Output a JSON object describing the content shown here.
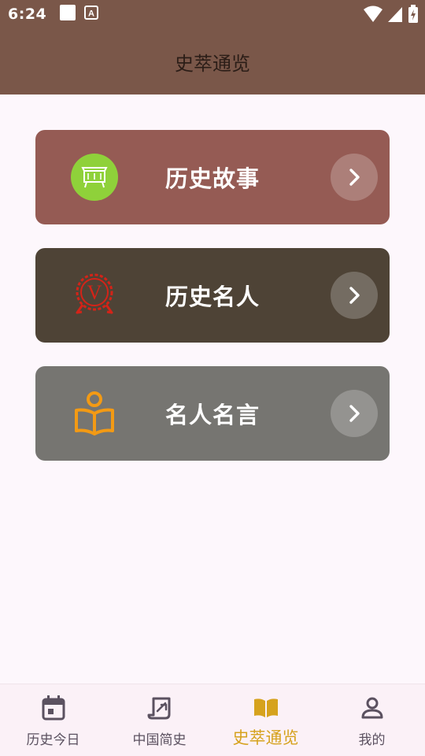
{
  "status_bar": {
    "time": "6:24",
    "icons": [
      "square-notification-icon",
      "font-a-notification-icon",
      "wifi-icon",
      "cell-signal-icon",
      "battery-charging-icon"
    ]
  },
  "app_bar": {
    "title": "史萃通览"
  },
  "cards": [
    {
      "label": "历史故事",
      "icon": "calligraphy-frame-icon",
      "background": "#955b54",
      "icon_color": "#8fd13a"
    },
    {
      "label": "历史名人",
      "icon": "v-seal-badge-icon",
      "background": "#4e4336",
      "icon_color": "#d42318"
    },
    {
      "label": "名人名言",
      "icon": "reading-person-icon",
      "background": "#767571",
      "icon_color": "#f39a14"
    }
  ],
  "bottom_nav": {
    "active_index": 2,
    "items": [
      {
        "label": "历史今日",
        "icon": "calendar-icon"
      },
      {
        "label": "中国简史",
        "icon": "scroll-history-icon"
      },
      {
        "label": "史萃通览",
        "icon": "open-book-icon"
      },
      {
        "label": "我的",
        "icon": "person-icon"
      }
    ]
  },
  "colors": {
    "header_background": "#7a5749",
    "page_background": "#fdf7fc",
    "nav_active": "#d6a21d",
    "nav_inactive": "#5b5160"
  }
}
